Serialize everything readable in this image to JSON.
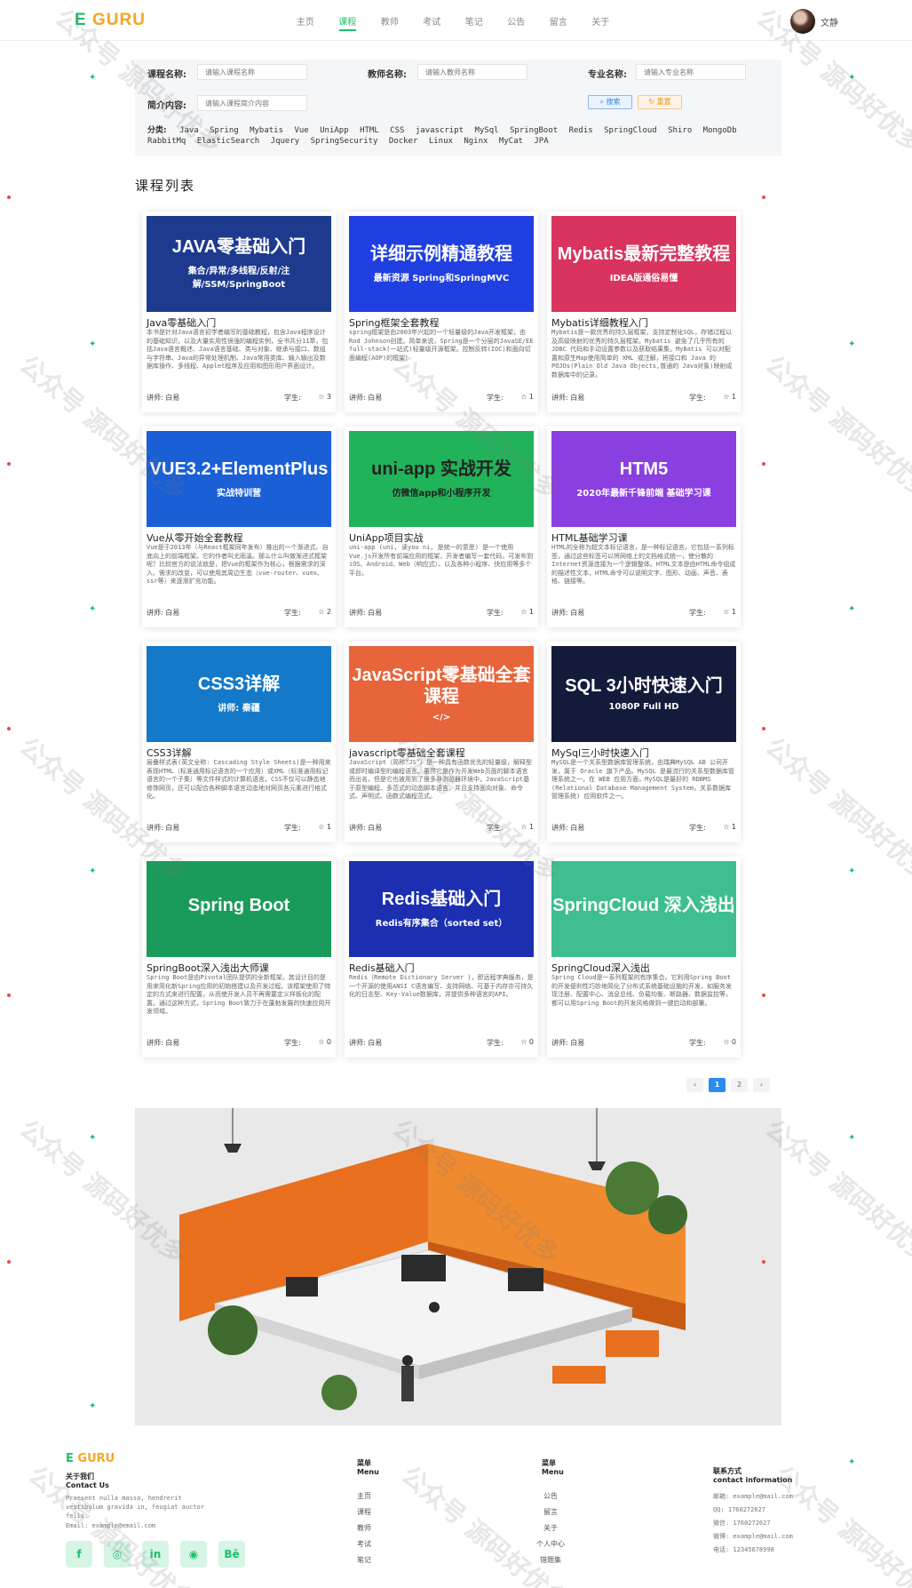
{
  "header": {
    "logo_e": "E",
    "logo_rest": "GURU",
    "nav": [
      "主页",
      "课程",
      "教师",
      "考试",
      "笔记",
      "公告",
      "留言",
      "关于"
    ],
    "active_nav": "课程",
    "user_name": "文静"
  },
  "search": {
    "course_label": "课程名称:",
    "course_placeholder": "请输入课程名称",
    "teacher_label": "教师名称:",
    "teacher_placeholder": "请输入教师名称",
    "major_label": "专业名称:",
    "major_placeholder": "请输入专业名称",
    "intro_label": "简介内容:",
    "intro_placeholder": "请输入课程简介内容",
    "search_btn": "搜索",
    "reset_btn": "重置",
    "category_label": "分类:",
    "categories": [
      "Java",
      "Spring",
      "Mybatis",
      "Vue",
      "UniApp",
      "HTML",
      "CSS",
      "javascript",
      "MySql",
      "SpringBoot",
      "Redis",
      "SpringCloud",
      "Shiro",
      "MongoDb",
      "RabbitMq",
      "ElasticSearch",
      "Jquery",
      "SpringSecurity",
      "Docker",
      "Linux",
      "Nginx",
      "MyCat",
      "JPA"
    ]
  },
  "section_title": "课程列表",
  "courses": [
    {
      "title": "Java零基础入门",
      "thumb_title": "JAVA零基础入门",
      "thumb_sub": "集合/异常/多线程/反射/注解/SSM/SpringBoot",
      "desc": "本书是针对Java语言初学者编写的基础教程，包含Java程序设计的基础知识，以及大量实用性很强的编程实例，全书共分11章，包括Java语言概述、Java语言基础、类与对象、继承与接口、数组与字符串、Java的异常处理机制、Java常用类库、输入输出及数据库操作、多线程、Applet程序及应用和图形用户界面设计。",
      "teacher": "讲师: 白易",
      "students": "学生:",
      "stars": "☆ 3",
      "bg": "#1d3a8f",
      "fg": "#ffffff"
    },
    {
      "title": "Spring框架全套教程",
      "thumb_title": "详细示例精通教程",
      "thumb_sub": "最新资源 Spring和SpringMVC",
      "desc": "spring框架是由2003年兴起的一个轻量级的Java开发框架，由Rod Johnson创建。简单来说，Spring是一个分层的JavaSE/EE full-stack(一站式)轻量级开源框架。控制反转(IOC)和面向切面编程(AOP)的框架！",
      "teacher": "讲师: 白易",
      "students": "学生:",
      "stars": "☆ 1",
      "bg": "#1f3fe0",
      "fg": "#ffffff"
    },
    {
      "title": "Mybatis详细教程入门",
      "thumb_title": "Mybatis最新完整教程",
      "thumb_sub": "IDEA版通俗易懂",
      "desc": "Mybatis是一款优秀的持久层框架，支持定制化SQL，存储过程以及高级映射的优秀的持久层框架。Mybatis 避免了几乎所有的 JDBC 代码和手动设置参数以及获取结果集。MyBatis 可以对配置和原生Map使用简单的 XML 或注解，将接口和 Java 的 POJOs(Plain Old Java Objects,普通的 Java对象)映射成数据库中的记录。",
      "teacher": "讲师: 白易",
      "students": "学生:",
      "stars": "☆ 1",
      "bg": "#d8345f",
      "fg": "#ffffff"
    },
    {
      "title": "Vue从零开始全套教程",
      "thumb_title": "VUE3.2+ElementPlus",
      "thumb_sub": "实战特训营",
      "desc": "Vue是于2013年（与React框架同年发布）推出的一个渐进式、自底向上的前端框架。它的作者叫尤雨溪。那么什么叫做渐进式框架呢？比较官方的说法就是，把Vue的框架作为核心，根据需求的深入、需求的改变，可以使用其周边生态（vue-router、vuex、ssr等）来逐渐扩充功能。",
      "teacher": "讲师: 白易",
      "students": "学生:",
      "stars": "☆ 2",
      "bg": "#1a5fd6",
      "fg": "#ffffff"
    },
    {
      "title": "UniApp项目实战",
      "thumb_title": "uni-app 实战开发",
      "thumb_sub": "仿微信app和小程序开发",
      "desc": "uni-app (uni, 读you ni, 是统一的意思) 是一个使用Vue.js开发所有前端应用的框架，开发者编写一套代码，可发布到iOS、Android、Web（响应式）、以及各种小程序、快应用等多个平台。",
      "teacher": "讲师: 白易",
      "students": "学生:",
      "stars": "☆ 1",
      "bg": "#21b35a",
      "fg": "#222222"
    },
    {
      "title": "HTML基础学习课",
      "thumb_title": "HTM5",
      "thumb_sub": "2020年最新千锋前端 基础学习课",
      "desc": "HTML的全称为超文本标记语言，是一种标记语言。它包括一系列标签，通过这些标签可以将网络上的文档格式统一，使分散的Internet资源连接为一个逻辑整体。HTML文本是由HTML命令组成的描述性文本，HTML命令可以说明文字、图形、动画、声音、表格、链接等。",
      "teacher": "讲师: 白易",
      "students": "学生:",
      "stars": "☆ 1",
      "bg": "#8a3fe0",
      "fg": "#ffffff"
    },
    {
      "title": "CSS3详解",
      "thumb_title": "CSS3详解",
      "thumb_sub": "讲师: 秦疆",
      "desc": "层叠样式表(英文全称: Cascading Style Sheets)是一种用来表现HTML（标准通用标记语言的一个应用）或XML（标准通用标记语言的一个子集）等文件样式的计算机语言。CSS不仅可以静态地修饰网页，还可以配合各种脚本语言动态地对网页各元素进行格式化。",
      "teacher": "讲师: 白易",
      "students": "学生:",
      "stars": "☆ 1",
      "bg": "#1479c9",
      "fg": "#ffffff"
    },
    {
      "title": "javascript零基础全套课程",
      "thumb_title": "JavaScript零基础全套课程",
      "thumb_sub": "</>",
      "desc": "JavaScript（简称“JS”）是一种具有函数优先的轻量级，解释型或即时编译型的编程语言。虽然它是作为开发Web页面的脚本语言而出名，但是它也被用到了很多非浏览器环境中，JavaScript基于原型编程、多范式的动态脚本语言，并且支持面向对象、命令式、声明式、函数式编程范式。",
      "teacher": "讲师: 白易",
      "students": "学生:",
      "stars": "☆ 1",
      "bg": "#e8643a",
      "fg": "#ffffff"
    },
    {
      "title": "MySql三小时快速入门",
      "thumb_title": "SQL 3小时快速入门",
      "thumb_sub": "1080P Full HD",
      "desc": "MySQL是一个关系型数据库管理系统，由瑞典MySQL AB 公司开发，属于 Oracle 旗下产品。MySQL 是最流行的关系型数据库管理系统之一，在 WEB 应用方面，MySQL是最好的 RDBMS (Relational Database Management System，关系数据库管理系统) 应用软件之一。",
      "teacher": "讲师: 白易",
      "students": "学生:",
      "stars": "☆ 1",
      "bg": "#141a3a",
      "fg": "#ffffff"
    },
    {
      "title": "SpringBoot深入浅出大师课",
      "thumb_title": "Spring Boot",
      "thumb_sub": "",
      "desc": "Spring Boot是由Pivotal团队提供的全新框架，其设计目的是用来简化新Spring应用的初始搭建以及开发过程。该框架使用了特定的方式来进行配置，从而使开发人员不再需要定义样板化的配置。通过这种方式，Spring Boot致力于在蓬勃发展的快速应用开发领域。",
      "teacher": "讲师: 白易",
      "students": "学生:",
      "stars": "☆ 0",
      "bg": "#1a9b5c",
      "fg": "#ffffff"
    },
    {
      "title": "Redis基础入门",
      "thumb_title": "Redis基础入门",
      "thumb_sub": "Redis有序集合（sorted set）",
      "desc": "Redis（Remote Dictionary Server )，即远程字典服务，是一个开源的使用ANSI C语言编写、支持网络、可基于内存亦可持久化的日志型、Key-Value数据库，并提供多种语言的API。",
      "teacher": "讲师: 白易",
      "students": "学生:",
      "stars": "☆ 0",
      "bg": "#1b2fb0",
      "fg": "#ffffff"
    },
    {
      "title": "SpringCloud深入浅出",
      "thumb_title": "SpringCloud 深入浅出",
      "thumb_sub": "",
      "desc": "Spring Cloud是一系列框架的有序集合。它利用Spring Boot的开发便利性巧妙地简化了分布式系统基础设施的开发，如服务发现注册、配置中心、消息总线、负载均衡、断路器、数据监控等，都可以用Spring Boot的开发风格做到一键启动和部署。",
      "teacher": "讲师: 白易",
      "students": "学生:",
      "stars": "☆ 0",
      "bg": "#3fbf8f",
      "fg": "#ffffff"
    }
  ],
  "pagination": {
    "prev": "‹",
    "pages": [
      "1",
      "2"
    ],
    "active": "1",
    "next": "›"
  },
  "footer": {
    "logo_e": "E",
    "logo_rest": "GURU",
    "about_title": "关于我们",
    "about_title_en": "Contact Us",
    "about_text": "Praesent nulla massa, hendrerit vestibulum gravida in, feugiat auctor felis.",
    "email": "Email: example@email.com",
    "socials": [
      "f",
      "◎",
      "in",
      "◉",
      "Bē"
    ],
    "menu1_title": "菜单",
    "menu1_title_en": "Menu",
    "menu1": [
      "主页",
      "课程",
      "教师",
      "考试",
      "笔记"
    ],
    "menu2_title": "菜单",
    "menu2_title_en": "Menu",
    "menu2": [
      "公告",
      "留言",
      "关于",
      "个人中心",
      "错题集"
    ],
    "contact_title": "联系方式",
    "contact_title_en": "contact information",
    "contact": [
      "邮箱: example@mail.com",
      "QQ: 1760272627",
      "微信: 1760272627",
      "微博: example@mail.com",
      "电话: 12345678998"
    ]
  },
  "watermark": "公众号 源码好优多"
}
